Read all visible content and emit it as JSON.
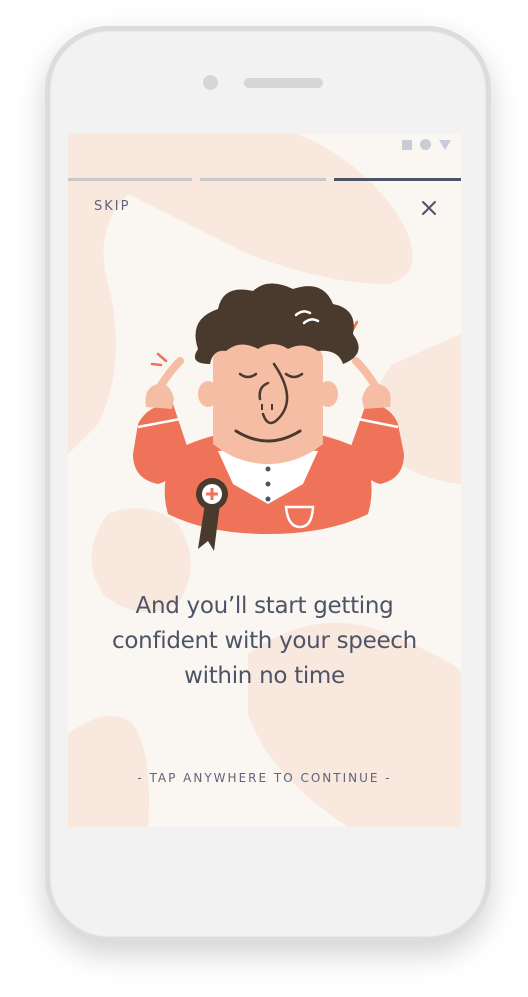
{
  "header": {
    "skip_label": "SKIP",
    "close_icon": "close-icon"
  },
  "status_bar": {
    "icons": [
      "square-icon",
      "circle-icon",
      "triangle-icon"
    ]
  },
  "progress": {
    "steps_total": 3,
    "current_step": 3
  },
  "content": {
    "illustration": "confident-man-with-award-ribbon",
    "headline": "And you’ll start getting confident with your speech within no time"
  },
  "footer": {
    "tap_hint": "- TAP ANYWHERE TO CONTINUE -"
  },
  "colors": {
    "background": "#faf6f1",
    "blob": "#f8e8de",
    "text": "#4e5467",
    "accent": "#ee7358",
    "hair": "#4a3a2e",
    "skin": "#f5bda3"
  }
}
